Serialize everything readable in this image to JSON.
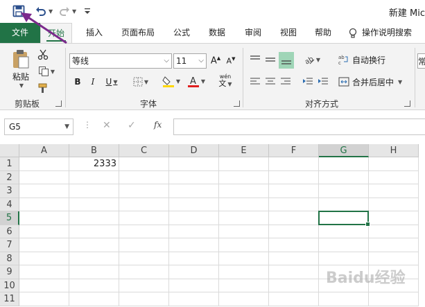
{
  "window": {
    "title": "新建 Mic"
  },
  "tabs": [
    "文件",
    "开始",
    "插入",
    "页面布局",
    "公式",
    "数据",
    "审阅",
    "视图",
    "帮助"
  ],
  "tell_me": "操作说明搜索",
  "clipboard": {
    "paste_label": "粘贴",
    "group_label": "剪贴板"
  },
  "font": {
    "name": "等线",
    "size": "11",
    "group_label": "字体",
    "font_color": "#e02020",
    "fill_color": "#ffd700",
    "phonetic": "wén"
  },
  "alignment": {
    "wrap_text": "自动换行",
    "merge_center": "合并后居中",
    "group_label": "对齐方式"
  },
  "number_group_partial": "常",
  "formula_bar": {
    "name_box": "G5",
    "fx": "fx",
    "value": ""
  },
  "columns": [
    "A",
    "B",
    "C",
    "D",
    "E",
    "F",
    "G",
    "H"
  ],
  "rows": [
    "1",
    "2",
    "3",
    "4",
    "5",
    "6",
    "7",
    "8",
    "9",
    "10",
    "11"
  ],
  "selected": {
    "column": "G",
    "row": "5"
  },
  "cells": {
    "B1": "2333"
  },
  "watermark": "Baidu经验",
  "colors": {
    "accent": "#217346",
    "annotation": "#7b2a8c"
  }
}
